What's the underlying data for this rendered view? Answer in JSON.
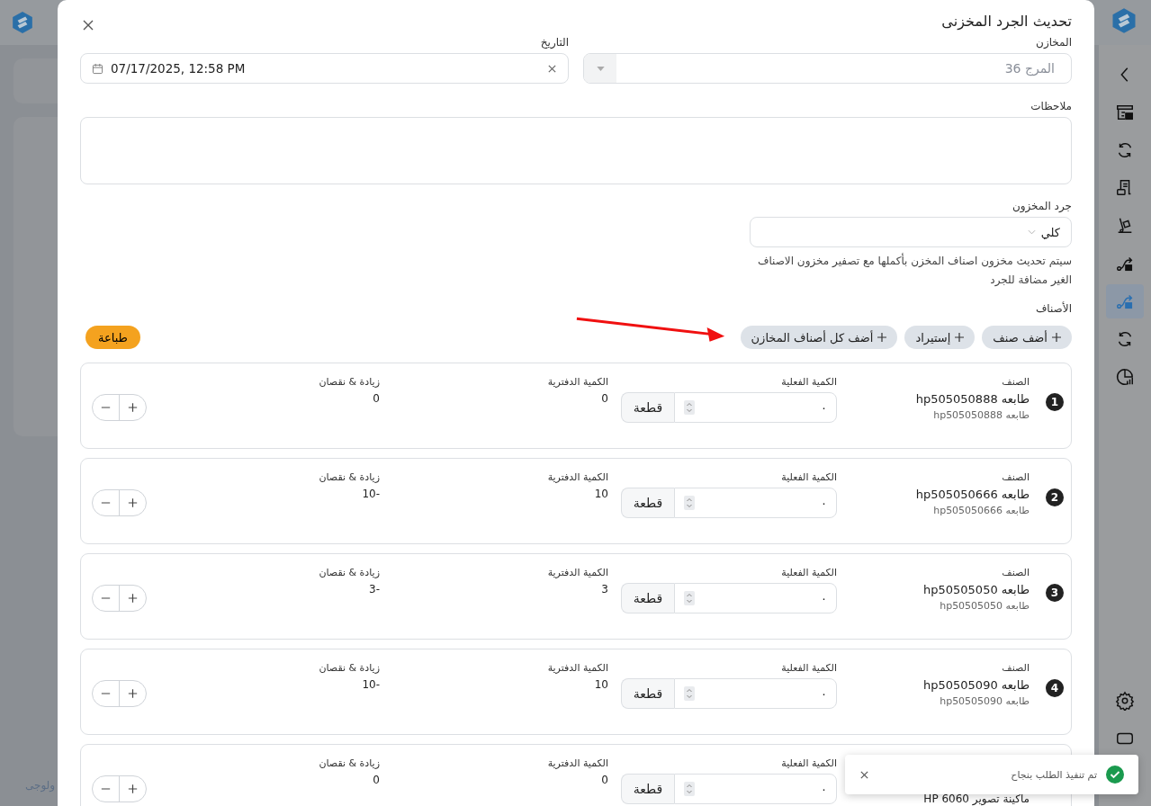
{
  "sidebar": {
    "items": [
      {
        "selected": false
      },
      {
        "selected": false
      },
      {
        "selected": false
      },
      {
        "selected": false
      },
      {
        "selected": false
      },
      {
        "selected": false
      },
      {
        "selected": true
      },
      {
        "selected": false
      },
      {
        "selected": false
      }
    ],
    "bottom_items": [
      {
        "selected": false
      },
      {
        "selected": false
      }
    ]
  },
  "footer_text": "ولوجى",
  "dialog": {
    "title": "تحديث الجرد المخزنى",
    "warehouse": {
      "label": "المخازن",
      "value": "المرج 36",
      "disabled": true
    },
    "date": {
      "label": "التاريخ",
      "value": "07/17/2025, 12:58 PM"
    },
    "notes": {
      "label": "ملاحظات"
    },
    "inventory": {
      "label": "جرد المخزون",
      "value": "كلي",
      "hint": "سيتم تحديث مخزون اصناف المخزن بأكملها مع تصفير مخزون الاصناف الغير مضافة للجرد"
    },
    "items_label": "الأصناف",
    "actions": [
      {
        "label": "أضف صنف"
      },
      {
        "label": "إستيراد"
      },
      {
        "label": "أضف كل أصناف المخازن"
      }
    ],
    "print_button": "طباعة",
    "items": [
      {
        "index": "1",
        "label": "الصنف",
        "name": "طابعه hp505050888",
        "code": "طابعه hp505050888",
        "actual_label": "الكمية الفعلية",
        "actual_value": "٠",
        "unit": "قطعة",
        "book_label": "الكمية الدفترية",
        "book_value": "0",
        "diff_label": "زيادة & نقصان",
        "diff_value": "0"
      },
      {
        "index": "2",
        "label": "الصنف",
        "name": "طابعه hp505050666",
        "code": "طابعه hp505050666",
        "actual_label": "الكمية الفعلية",
        "actual_value": "٠",
        "unit": "قطعة",
        "book_label": "الكمية الدفترية",
        "book_value": "10",
        "diff_label": "زيادة & نقصان",
        "diff_value": "-10"
      },
      {
        "index": "3",
        "label": "الصنف",
        "name": "طابعه hp50505050",
        "code": "طابعه hp50505050",
        "actual_label": "الكمية الفعلية",
        "actual_value": "٠",
        "unit": "قطعة",
        "book_label": "الكمية الدفترية",
        "book_value": "3",
        "diff_label": "زيادة & نقصان",
        "diff_value": "-3"
      },
      {
        "index": "4",
        "label": "الصنف",
        "name": "طابعه hp50505090",
        "code": "طابعه hp50505090",
        "actual_label": "الكمية الفعلية",
        "actual_value": "٠",
        "unit": "قطعة",
        "book_label": "الكمية الدفترية",
        "book_value": "10",
        "diff_label": "زيادة & نقصان",
        "diff_value": "-10"
      },
      {
        "name": "ماكينة تصوير HP 6060",
        "actual_label": "الكمية الفعلية",
        "actual_value": "٠",
        "unit": "قطعة",
        "book_label": "الكمية الدفترية",
        "book_value": "0",
        "diff_label": "زيادة & نقصان",
        "diff_value": "0"
      }
    ],
    "toast": {
      "message": "تم تنفيذ الطلب بنجاح"
    }
  }
}
